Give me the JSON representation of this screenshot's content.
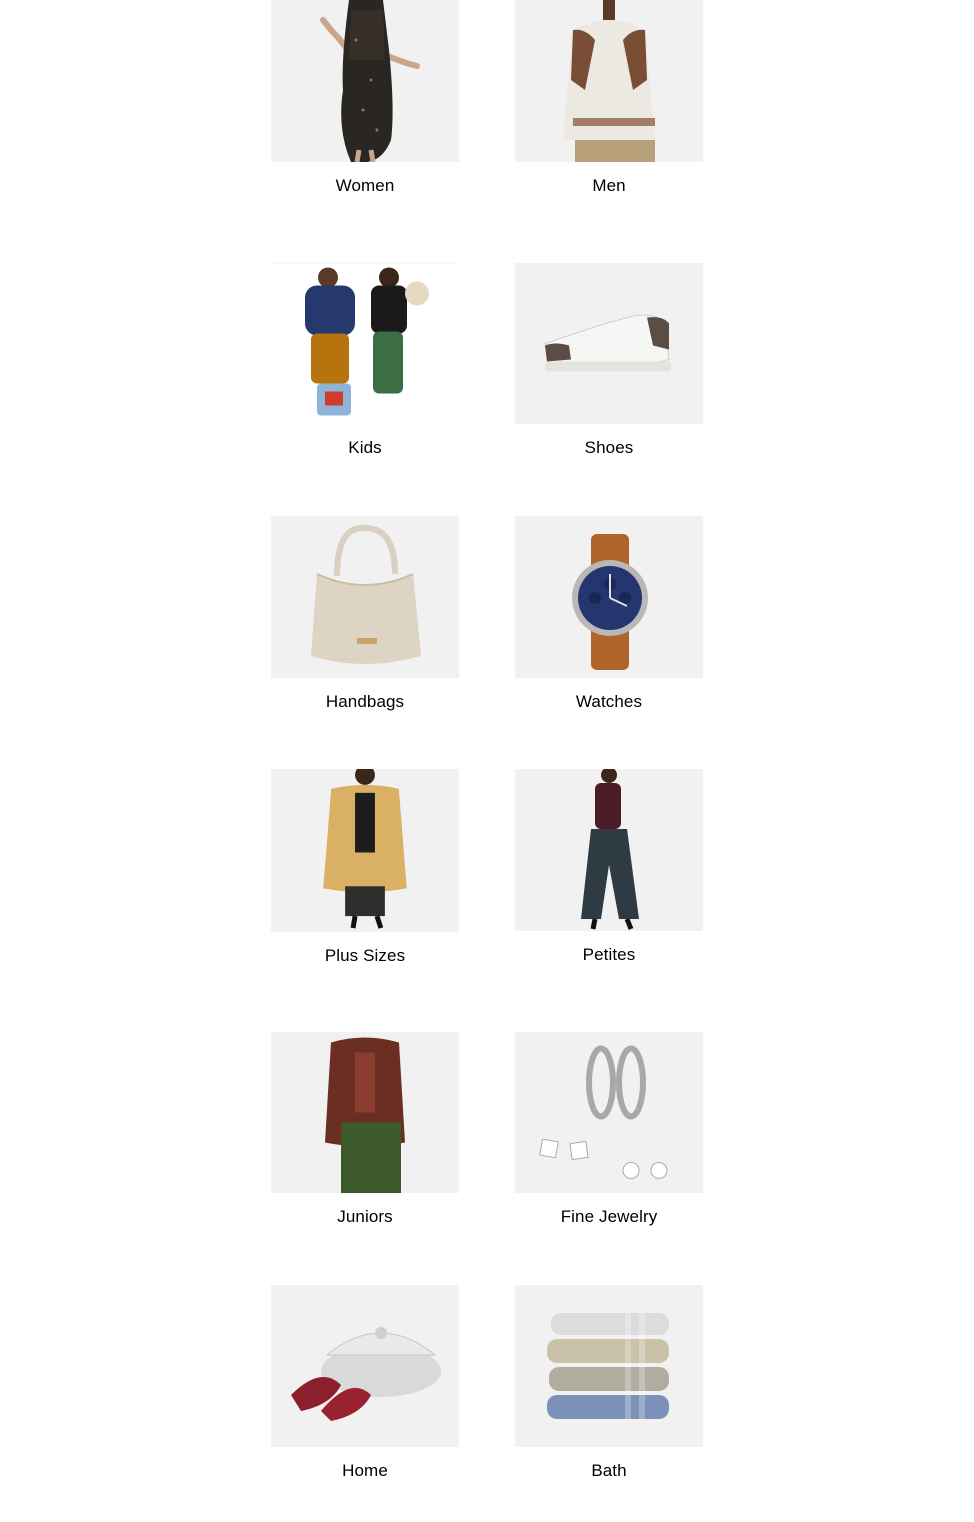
{
  "categories": [
    {
      "label": "Women",
      "icon": "women-dress-image"
    },
    {
      "label": "Men",
      "icon": "men-sweater-image"
    },
    {
      "label": "Kids",
      "icon": "kids-image"
    },
    {
      "label": "Shoes",
      "icon": "sneaker-image"
    },
    {
      "label": "Handbags",
      "icon": "handbag-image"
    },
    {
      "label": "Watches",
      "icon": "watch-image"
    },
    {
      "label": "Plus Sizes",
      "icon": "plus-sizes-image"
    },
    {
      "label": "Petites",
      "icon": "petites-image"
    },
    {
      "label": "Juniors",
      "icon": "juniors-image"
    },
    {
      "label": "Fine Jewelry",
      "icon": "jewelry-image"
    },
    {
      "label": "Home",
      "icon": "roaster-image"
    },
    {
      "label": "Bath",
      "icon": "towels-image"
    }
  ]
}
